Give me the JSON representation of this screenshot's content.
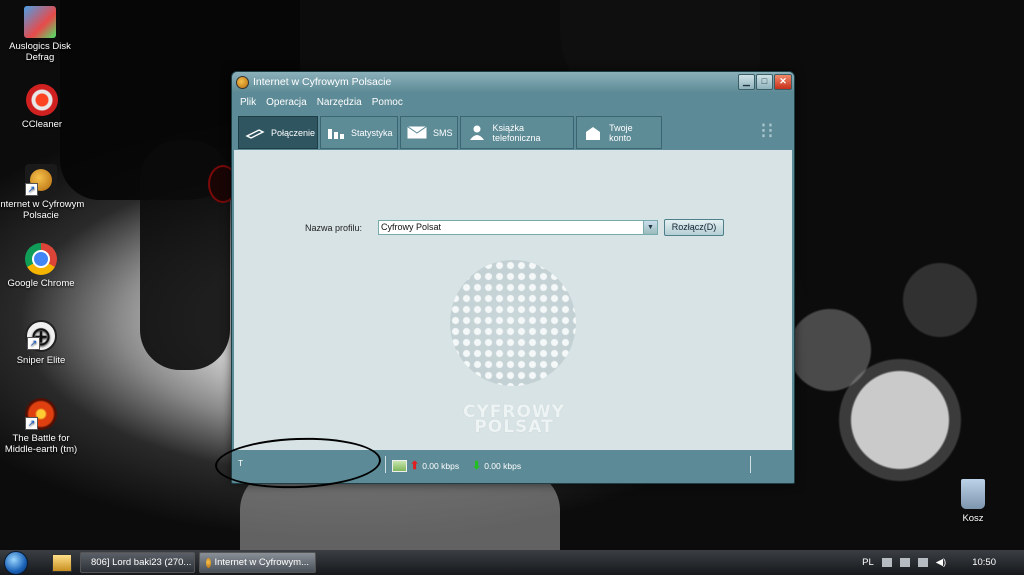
{
  "desktop": {
    "icons": [
      {
        "label": "Auslogics Disk Defrag"
      },
      {
        "label": "CCleaner"
      },
      {
        "label": "Internet w Cyfrowym Polsacie"
      },
      {
        "label": "Google Chrome"
      },
      {
        "label": "Sniper Elite"
      },
      {
        "label": "The Battle for Middle-earth (tm)"
      },
      {
        "label": "Kosz"
      }
    ]
  },
  "window": {
    "title": "Internet w Cyfrowym Polsacie",
    "menu": [
      "Plik",
      "Operacja",
      "Narzędzia",
      "Pomoc"
    ],
    "tabs": [
      {
        "label": "Połączenie",
        "icon": "plug-icon",
        "active": true
      },
      {
        "label": "Statystyka",
        "icon": "bar-chart-icon"
      },
      {
        "label": "SMS",
        "icon": "envelope-icon"
      },
      {
        "label": "Książka telefoniczna",
        "icon": "person-icon"
      },
      {
        "label": "Twoje konto",
        "icon": "house-icon"
      }
    ],
    "profile": {
      "label": "Nazwa profilu:",
      "value": "Cyfrowy Polsat",
      "disconnect_label": "Rozłącz(D)"
    },
    "logo": {
      "line1": "CYFROWY",
      "line2": "POLSAT"
    },
    "status": {
      "left": "T",
      "upload": "0.00 kbps",
      "download": "0.00 kbps"
    }
  },
  "taskbar": {
    "tasks": [
      {
        "label": "806] Lord baki23 (270...",
        "active": false
      },
      {
        "label": "Internet w Cyfrowym...",
        "active": true
      }
    ],
    "language": "PL",
    "clock": "10:50"
  },
  "colors": {
    "window_frame": "#5c8a96",
    "content_bg": "#d8e3e5",
    "active_tab": "#2f5560"
  }
}
